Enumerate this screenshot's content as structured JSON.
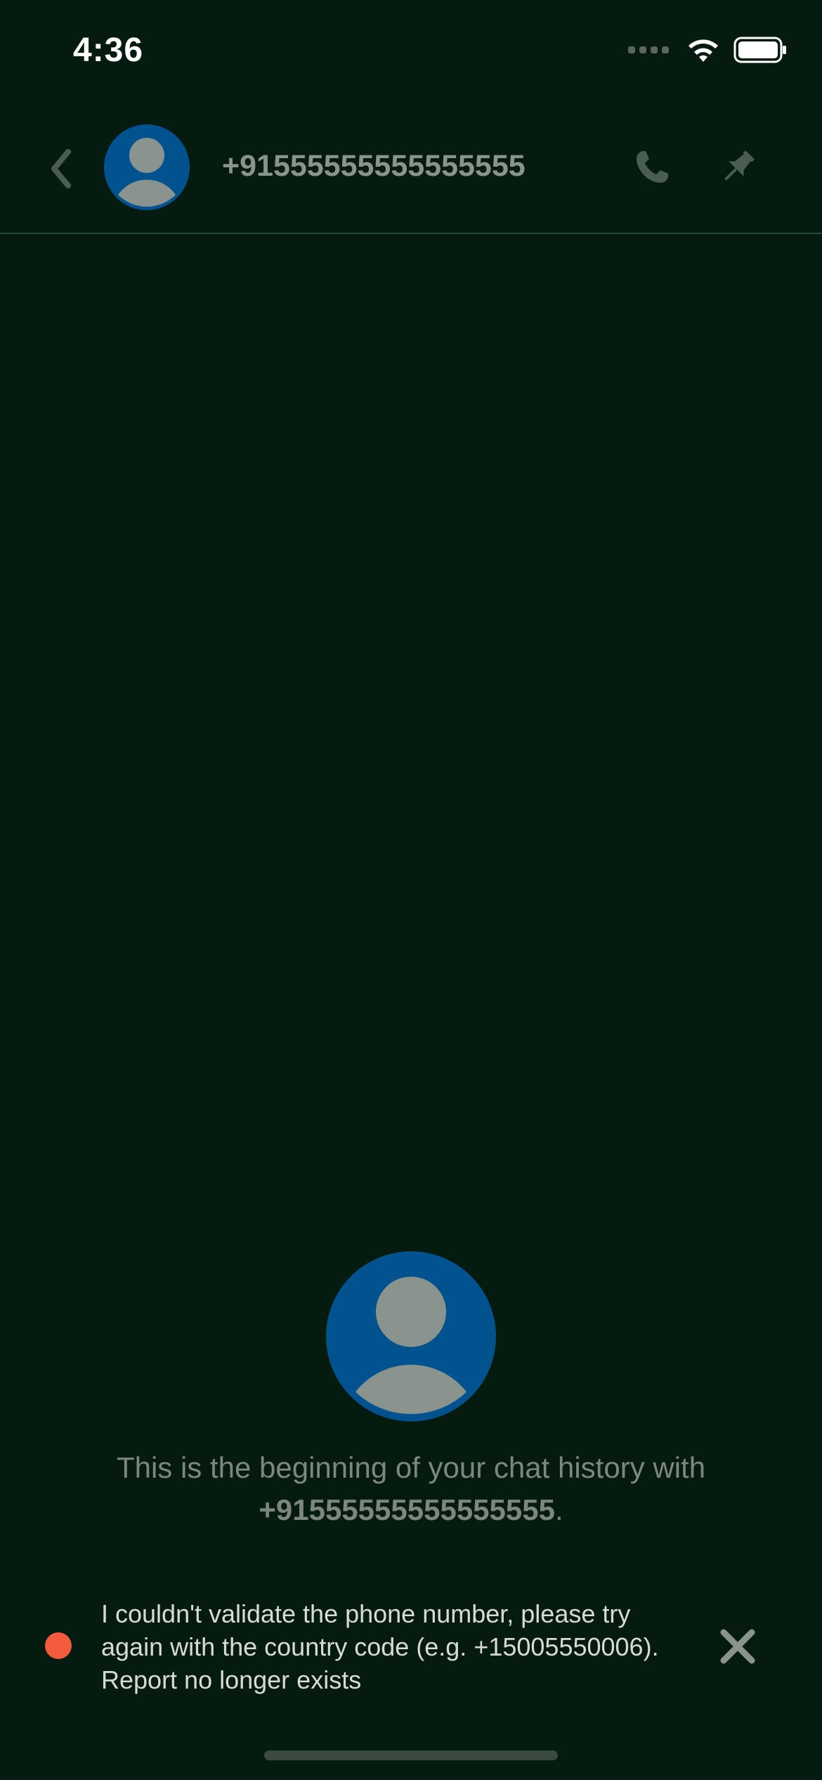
{
  "status_bar": {
    "time": "4:36"
  },
  "header": {
    "contact_name": "+91555555555555555",
    "back_icon": "chevron-left-icon",
    "call_icon": "phone-icon",
    "pin_icon": "pin-icon"
  },
  "intro": {
    "text_prefix": "This is the beginning of your chat history with",
    "contact_name": "+91555555555555555",
    "suffix": "."
  },
  "error": {
    "line1": "I couldn't validate the phone number, please try",
    "line2": "again with the country code (e.g. +15005550006).",
    "line3": "Report no longer exists",
    "dot_color": "#f25b3b"
  },
  "colors": {
    "background": "#061b0f",
    "avatar": "#02528f",
    "muted_text": "#7d8781"
  }
}
